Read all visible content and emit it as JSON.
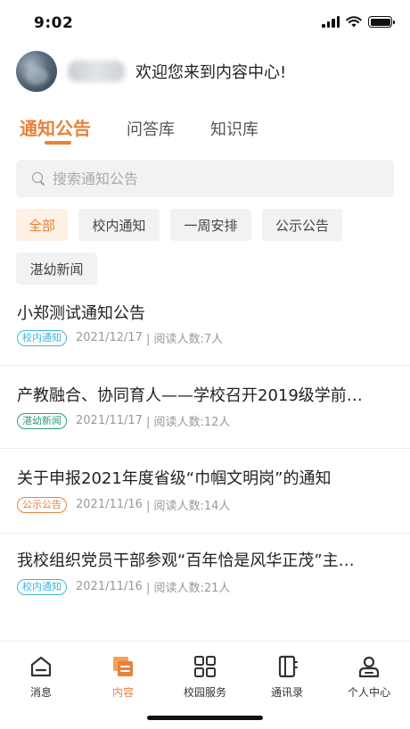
{
  "status_bar": {
    "time": "9:02",
    "icons": [
      "signal-icon",
      "wifi-icon",
      "battery-icon"
    ]
  },
  "header": {
    "welcome_text": "欢迎您来到内容中心!"
  },
  "tabs": [
    {
      "label": "通知公告",
      "active": true
    },
    {
      "label": "问答库",
      "active": false
    },
    {
      "label": "知识库",
      "active": false
    }
  ],
  "search": {
    "placeholder": "搜索通知公告",
    "value": ""
  },
  "filters": [
    {
      "label": "全部",
      "active": true
    },
    {
      "label": "校内通知",
      "active": false
    },
    {
      "label": "一周安排",
      "active": false
    },
    {
      "label": "公示公告",
      "active": false
    },
    {
      "label": "湛幼新闻",
      "active": false
    }
  ],
  "news": [
    {
      "title": "小郑测试通知公告",
      "tag": "校内通知",
      "date": "2021/12/17",
      "readers": "| 阅读人数:7人"
    },
    {
      "title": "产教融合、协同育人——学校召开2019级学前…",
      "tag": "湛幼新闻",
      "date": "2021/11/17",
      "readers": "| 阅读人数:12人"
    },
    {
      "title": "关于申报2021年度省级“巾帼文明岗”的通知",
      "tag": "公示公告",
      "date": "2021/11/16",
      "readers": "| 阅读人数:14人"
    },
    {
      "title": "我校组织党员干部参观“百年恰是风华正茂”主…",
      "tag": "校内通知",
      "date": "2021/11/16",
      "readers": "| 阅读人数:21人"
    }
  ],
  "tag_colors": {
    "校内通知": "#3fb6d8",
    "湛幼新闻": "#2e9c7a",
    "公示公告": "#e8813a"
  },
  "accent_color": "#e8813a",
  "bottom_nav": [
    {
      "label": "消息",
      "icon": "home-icon",
      "active": false
    },
    {
      "label": "内容",
      "icon": "content-icon",
      "active": true
    },
    {
      "label": "校园服务",
      "icon": "grid-icon",
      "active": false
    },
    {
      "label": "通讯录",
      "icon": "contacts-icon",
      "active": false
    },
    {
      "label": "个人中心",
      "icon": "user-icon",
      "active": false
    }
  ]
}
